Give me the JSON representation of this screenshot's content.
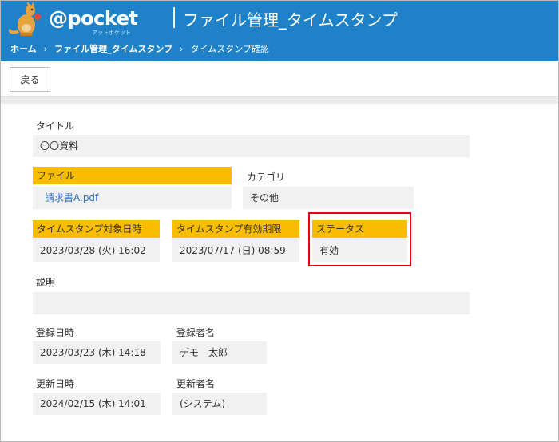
{
  "header": {
    "logo_text": "@pocket",
    "logo_sub": "アットポケット",
    "title": "ファイル管理_タイムスタンプ"
  },
  "breadcrumb": {
    "items": [
      "ホーム",
      "ファイル管理_タイムスタンプ",
      "タイムスタンプ確認"
    ],
    "separator": "›"
  },
  "toolbar": {
    "back_label": "戻る"
  },
  "fields": {
    "title": {
      "label": "タイトル",
      "value": "〇〇資料"
    },
    "file": {
      "label": "ファイル",
      "value": "請求書A.pdf"
    },
    "category": {
      "label": "カテゴリ",
      "value": "その他"
    },
    "ts_target_datetime": {
      "label": "タイムスタンプ対象日時",
      "value": "2023/03/28 (火) 16:02"
    },
    "ts_expiry": {
      "label": "タイムスタンプ有効期限",
      "value": "2023/07/17 (日) 08:59"
    },
    "status": {
      "label": "ステータス",
      "value": "有効"
    },
    "description": {
      "label": "説明",
      "value": ""
    },
    "registered_at": {
      "label": "登録日時",
      "value": "2023/03/23 (木) 14:18"
    },
    "registered_by": {
      "label": "登録者名",
      "value": "デモ　太郎"
    },
    "updated_at": {
      "label": "更新日時",
      "value": "2024/02/15 (木) 14:01"
    },
    "updated_by": {
      "label": "更新者名",
      "value": "(システム)"
    }
  },
  "colors": {
    "header_blue": "#1f81c8",
    "highlight_label": "#f9bd00",
    "annotation_red": "#e60012",
    "value_bg": "#f1f1f1"
  }
}
